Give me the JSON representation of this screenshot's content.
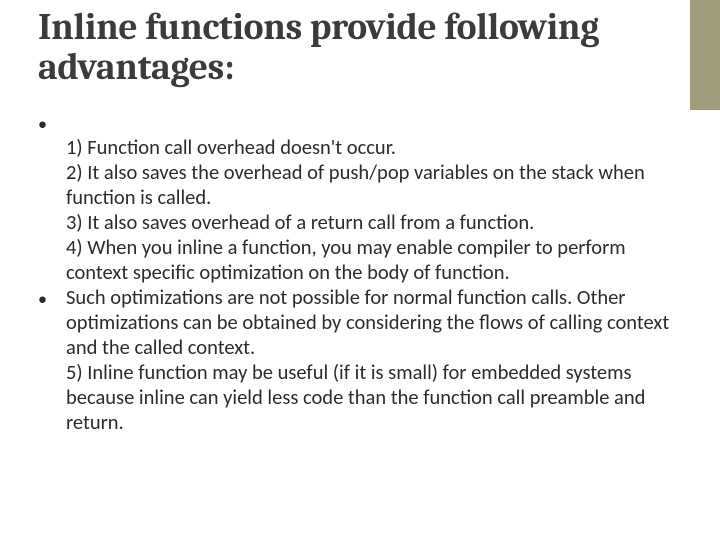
{
  "title": "Inline functions provide following advantages:",
  "bullets": {
    "b1": {
      "l1": "1) Function call overhead doesn't occur.",
      "l2": "2) It also saves the overhead of push/pop variables on the stack when function is called.",
      "l3": "3) It also saves overhead of a return call from a function.",
      "l4": "4) When you inline a function, you may enable compiler to perform context specific optimization on the body of function."
    },
    "b2": {
      "l1": " Such optimizations are not possible for normal function calls. Other optimizations can be obtained by considering the flows of calling context and the called context.",
      "l2": "5) Inline function may be useful (if it is small) for embedded systems because inline can yield less code than the function call preamble and return."
    }
  }
}
